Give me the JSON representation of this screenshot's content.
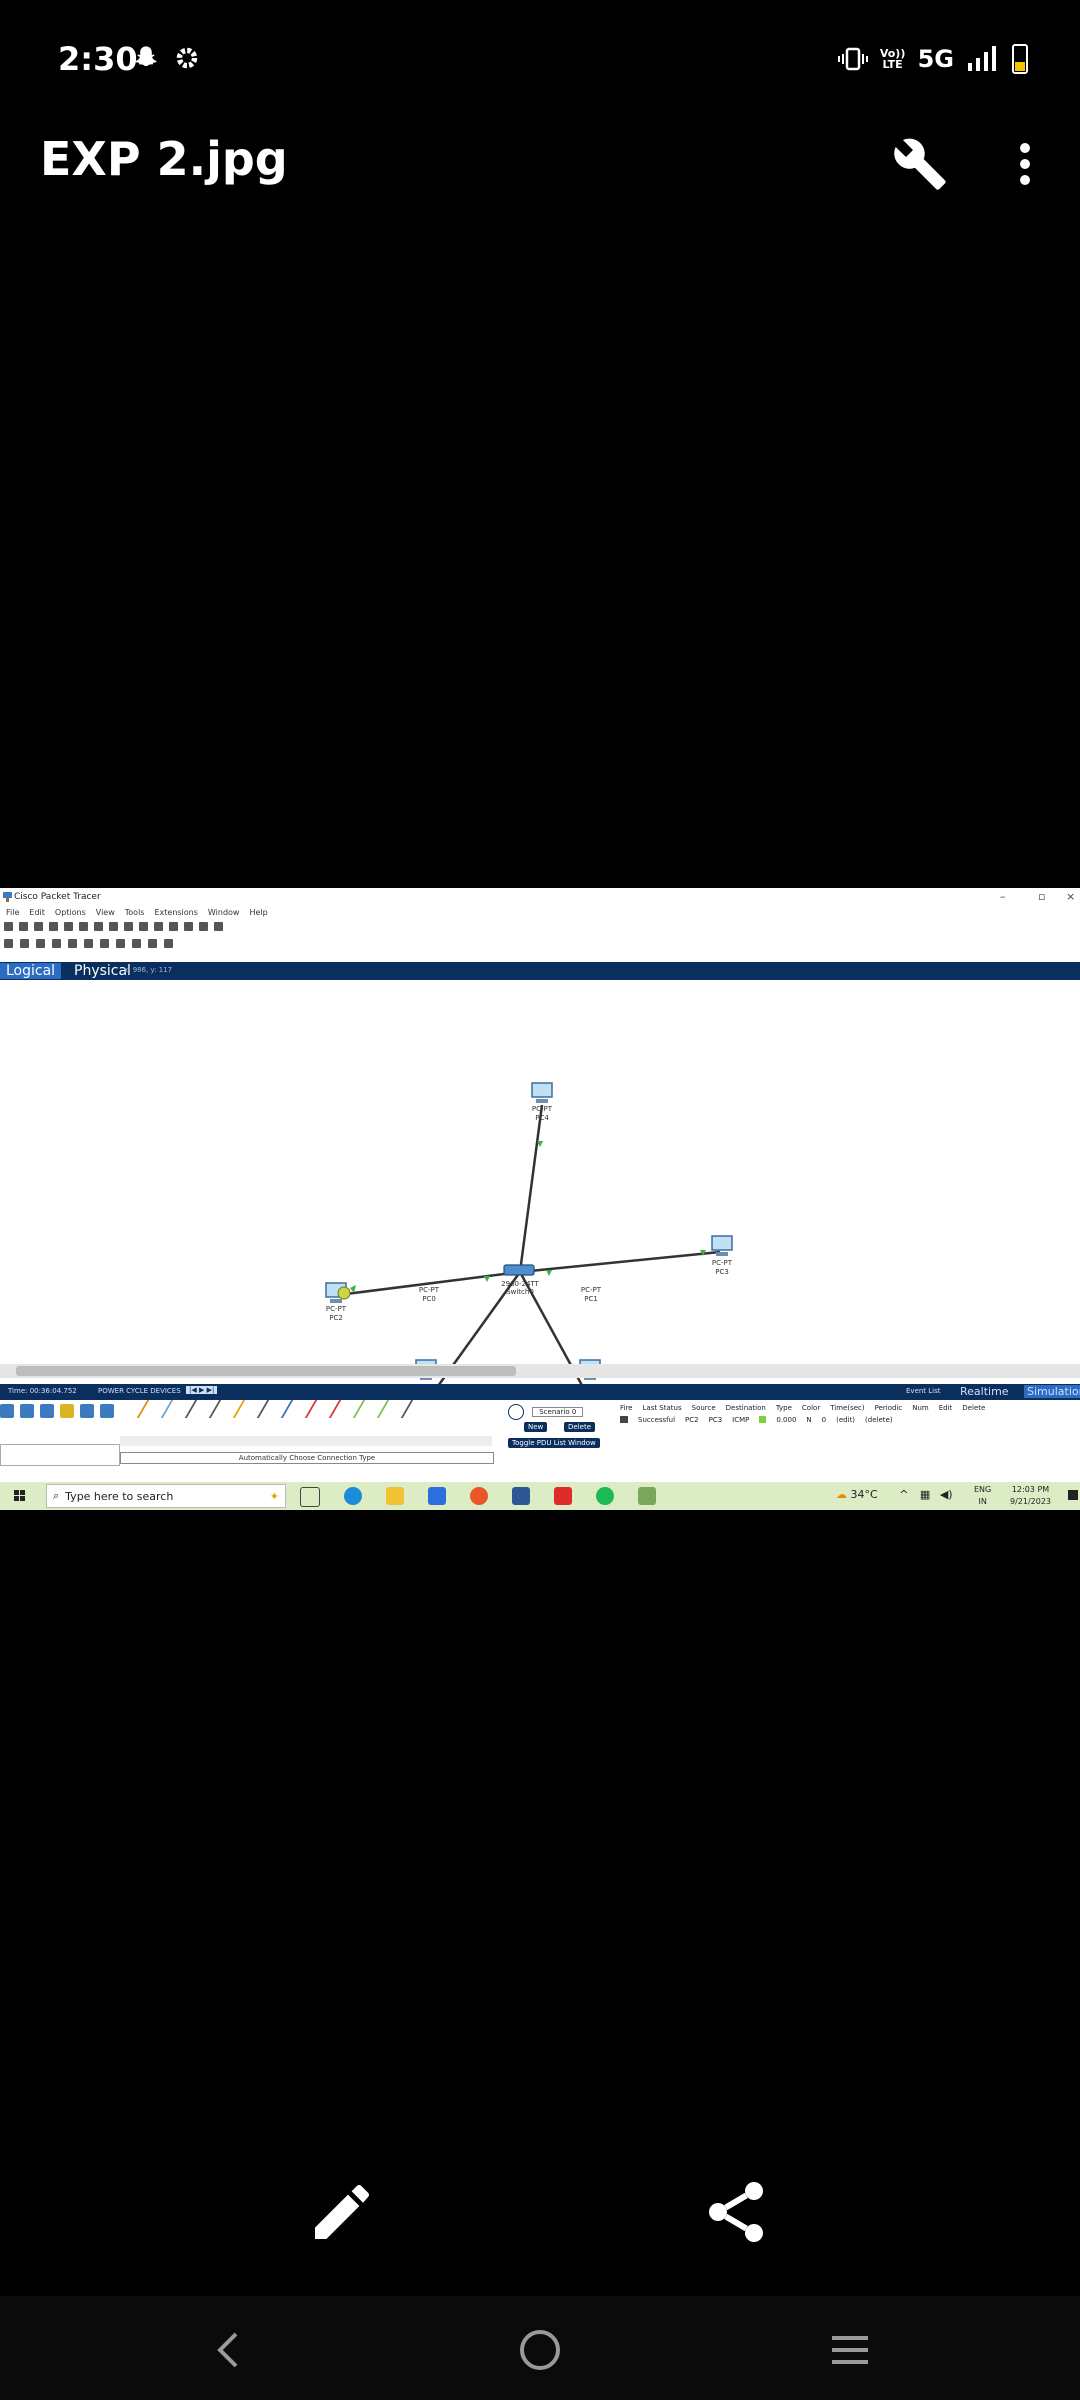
{
  "status_bar": {
    "time": "2:30",
    "network": "5G",
    "volte": "Vo)) LTE"
  },
  "app_bar": {
    "title": "EXP 2.jpg"
  },
  "screenshot": {
    "window_title": "Cisco Packet Tracer",
    "menu": [
      "File",
      "Edit",
      "Options",
      "View",
      "Tools",
      "Extensions",
      "Window",
      "Help"
    ],
    "tabs": {
      "logical": "Logical",
      "physical": "Physical",
      "coords": "x: 986, y: 117"
    },
    "nodes": [
      {
        "label1": "PC-PT",
        "label2": "PC4"
      },
      {
        "label1": "PC-PT",
        "label2": "PC2"
      },
      {
        "label1": "PC-PT",
        "label2": "PC3"
      },
      {
        "label1": "PC-PT",
        "label2": "PC0"
      },
      {
        "label1": "PC-PT",
        "label2": "PC1"
      },
      {
        "label1": "2960-24TT",
        "label2": "Switch0"
      }
    ],
    "timebar": {
      "time": "Time: 00:36:04.752",
      "power": "POWER CYCLE DEVICES",
      "event_list": "Event List",
      "realtime": "Realtime",
      "simulation": "Simulation"
    },
    "connection_label": "Automatically Choose Connection Type",
    "scenario": {
      "name": "Scenario 0",
      "new": "New",
      "delete": "Delete",
      "toggle": "Toggle PDU List Window"
    },
    "pdu_headers": [
      "Fire",
      "Last Status",
      "Source",
      "Destination",
      "Type",
      "Color",
      "Time(sec)",
      "Periodic",
      "Num",
      "Edit",
      "Delete"
    ],
    "pdu_row": [
      "",
      "Successful",
      "PC2",
      "PC3",
      "ICMP",
      "",
      "0.000",
      "N",
      "0",
      "(edit)",
      "(delete)"
    ],
    "taskbar": {
      "search_placeholder": "Type here to search",
      "weather": "34°C",
      "lang1": "ENG",
      "lang2": "IN",
      "clock_time": "12:03 PM",
      "clock_date": "9/21/2023"
    }
  },
  "colors": {
    "background": "#000000",
    "packet_tracer_blue": "#0a2f5e",
    "link_green": "#3cb043",
    "taskbar": "#dcecc4"
  }
}
